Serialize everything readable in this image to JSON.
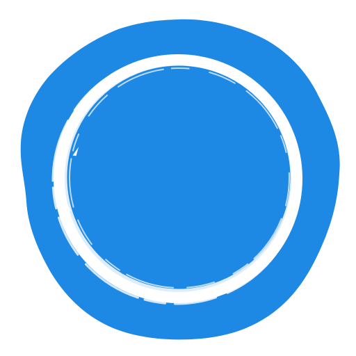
{
  "icon": {
    "name": "wax-seal-icon",
    "colors": {
      "seal": "#1e88e5",
      "ring": "#ffffff",
      "background": "#ffffff"
    }
  }
}
